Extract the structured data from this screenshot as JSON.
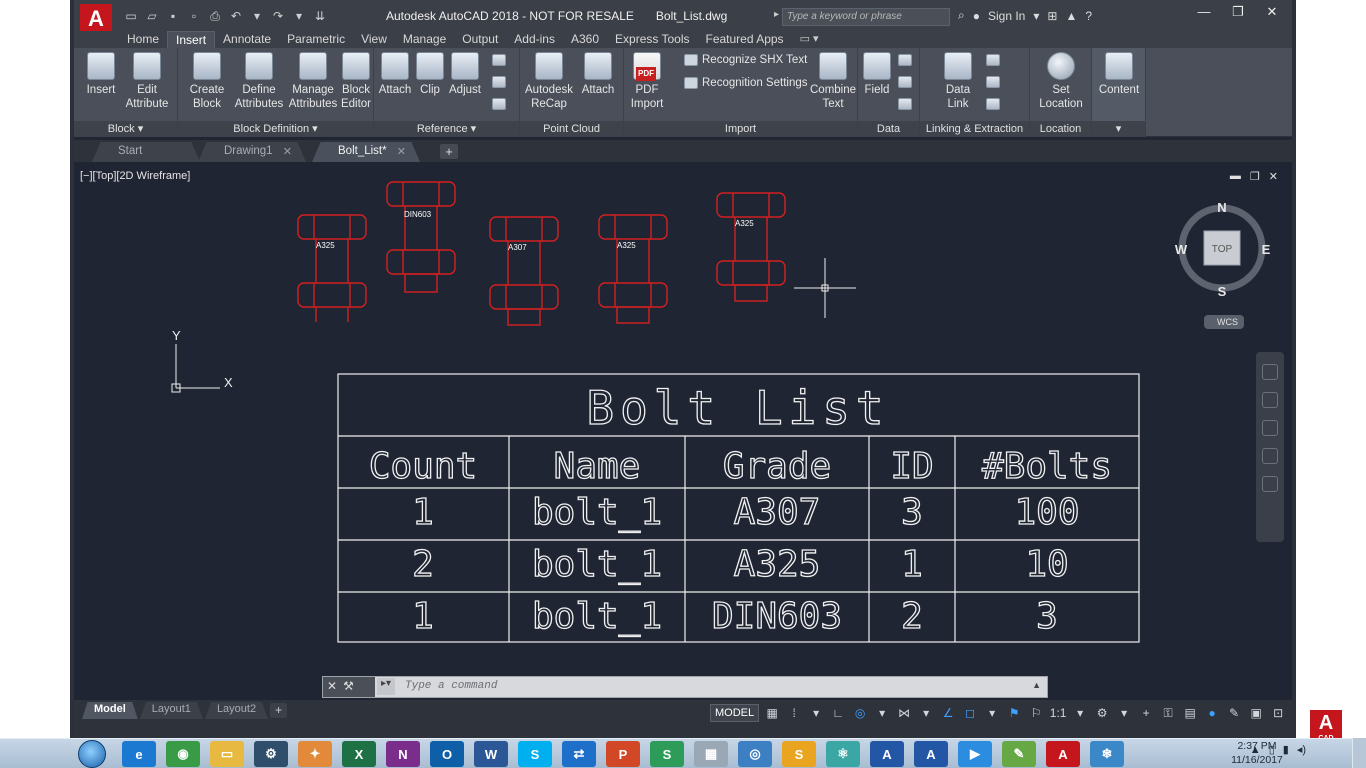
{
  "titlebar": {
    "app_title": "Autodesk AutoCAD 2018 - NOT FOR RESALE",
    "file_name": "Bolt_List.dwg",
    "search_placeholder": "Type a keyword or phrase",
    "sign_in": "Sign In",
    "app_logo": "A"
  },
  "ribbon_tabs": [
    "Home",
    "Insert",
    "Annotate",
    "Parametric",
    "View",
    "Manage",
    "Output",
    "Add-ins",
    "A360",
    "Express Tools",
    "Featured Apps"
  ],
  "active_tab": "Insert",
  "panels": {
    "block": {
      "title": "Block",
      "insert": "Insert",
      "edit_attribute": "Edit Attribute"
    },
    "block_definition": {
      "title": "Block Definition",
      "create_block": "Create Block",
      "define_attributes": "Define Attributes",
      "manage_attributes": "Manage Attributes",
      "block_editor": "Block Editor"
    },
    "reference": {
      "title": "Reference",
      "attach": "Attach",
      "clip": "Clip",
      "adjust": "Adjust"
    },
    "point_cloud": {
      "title": "Point Cloud",
      "recap": "Autodesk ReCap",
      "attach": "Attach"
    },
    "import": {
      "title": "Import",
      "pdf_import": "PDF Import",
      "recognize_shx": "Recognize SHX Text",
      "recognition_settings": "Recognition Settings",
      "combine_text": "Combine Text"
    },
    "data": {
      "title": "Data",
      "field": "Field"
    },
    "linking": {
      "title": "Linking & Extraction",
      "data_link": "Data Link"
    },
    "location": {
      "title": "Location",
      "set_location": "Set Location"
    },
    "content": {
      "title": "",
      "content": "Content"
    }
  },
  "file_tabs": [
    {
      "label": "Start",
      "active": false
    },
    {
      "label": "Drawing1",
      "active": false
    },
    {
      "label": "Bolt_List*",
      "active": true
    }
  ],
  "viewport": {
    "label": "[−][Top][2D Wireframe]",
    "bolt_labels": [
      "A325",
      "DIN603",
      "A307",
      "A325",
      "A325"
    ],
    "ucs_x": "X",
    "ucs_y": "Y"
  },
  "viewcube": {
    "n": "N",
    "s": "S",
    "e": "E",
    "w": "W",
    "top": "TOP",
    "wcs": "WCS"
  },
  "table": {
    "title": "Bolt List",
    "headers": [
      "Count",
      "Name",
      "Grade",
      "ID",
      "#Bolts"
    ],
    "rows": [
      [
        "1",
        "bolt_1",
        "A307",
        "3",
        "100"
      ],
      [
        "2",
        "bolt_1",
        "A325",
        "1",
        "10"
      ],
      [
        "1",
        "bolt_1",
        "DIN603",
        "2",
        "3"
      ]
    ]
  },
  "command": {
    "placeholder": "Type a command"
  },
  "layout_tabs": [
    "Model",
    "Layout1",
    "Layout2"
  ],
  "status": {
    "model": "MODEL",
    "scale": "1:1"
  },
  "taskbar": {
    "time": "2:37 PM",
    "date": "11/16/2017"
  },
  "colors": {
    "bolt": "#d42020",
    "table_line": "#f0f0f0",
    "background": "#1f2533"
  }
}
